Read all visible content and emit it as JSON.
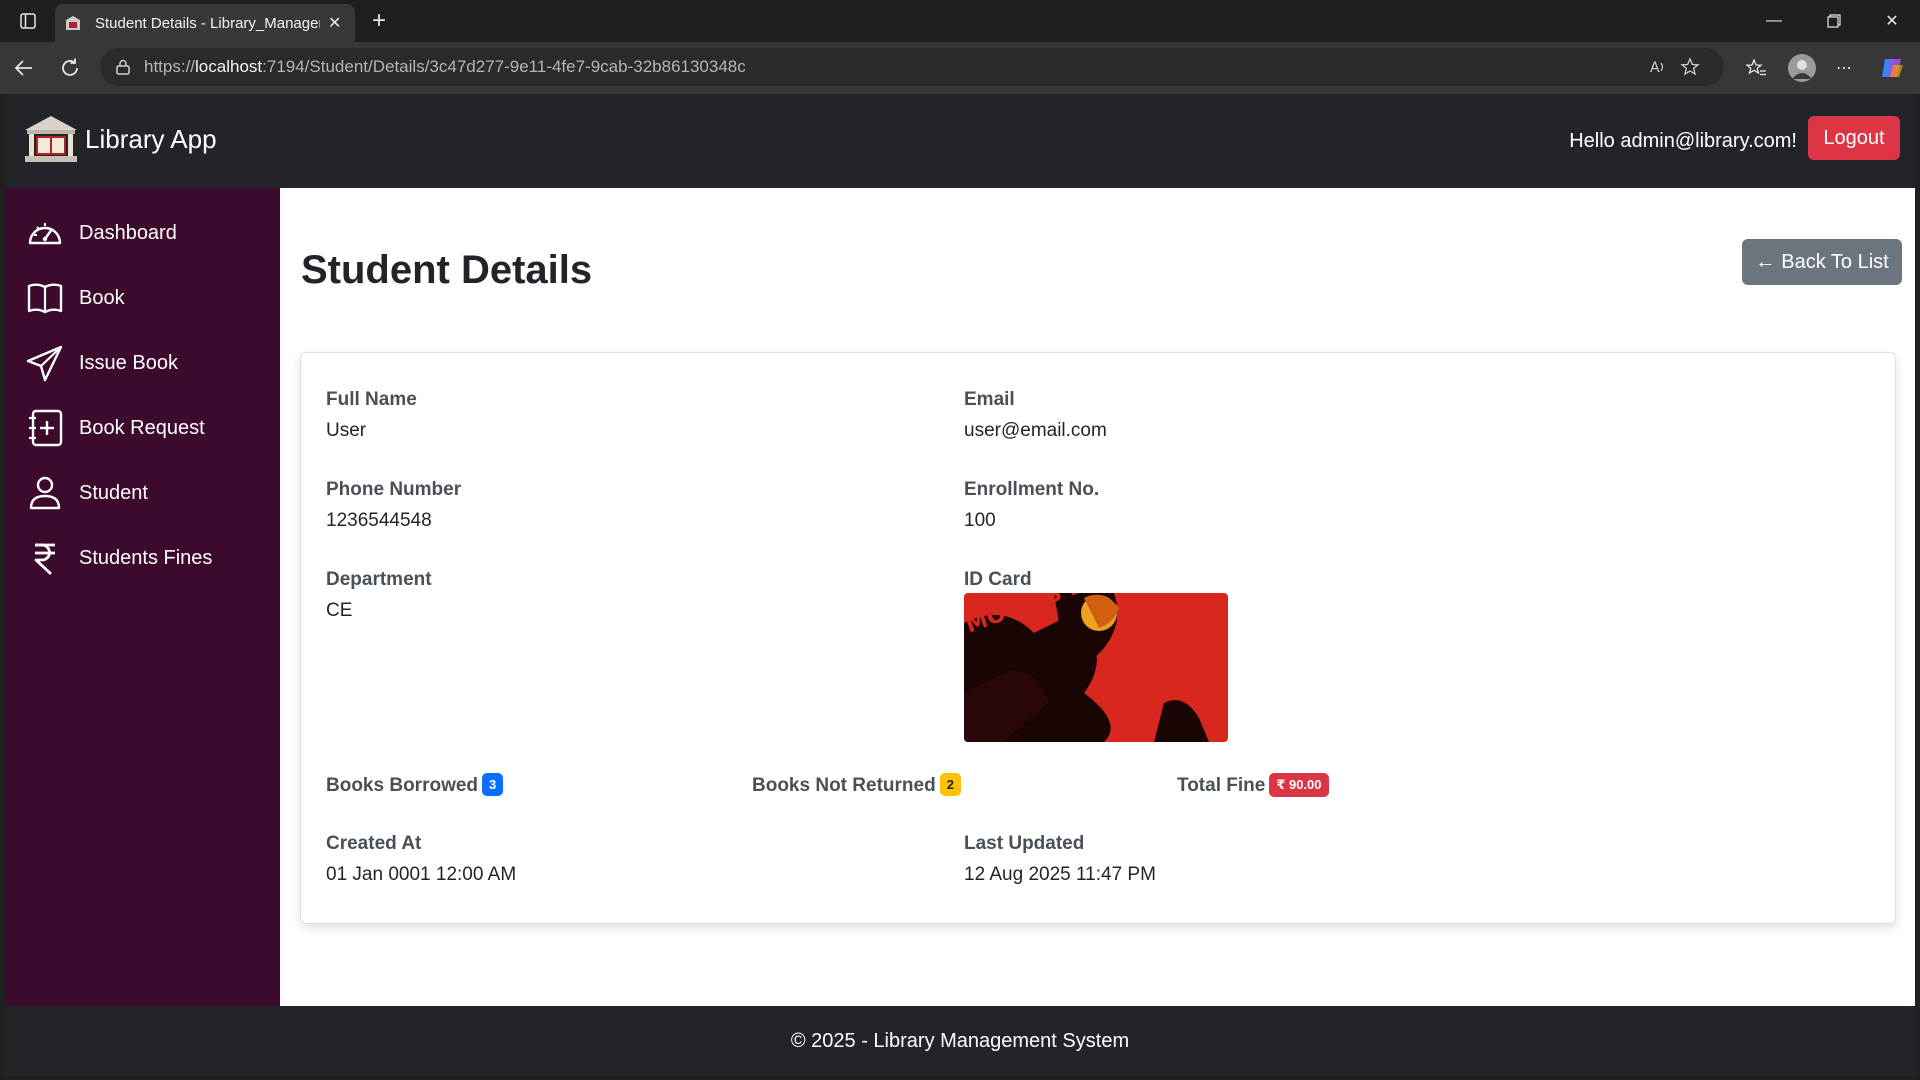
{
  "browser": {
    "tab_title": "Student Details - Library_Management",
    "url_prefix": "https://",
    "url_host": "localhost",
    "url_rest": ":7194/Student/Details/3c47d277-9e11-4fe7-9cab-32b86130348c"
  },
  "app": {
    "brand": "Library App",
    "greeting": "Hello admin@library.com!",
    "logout_label": "Logout"
  },
  "sidebar": {
    "items": [
      {
        "label": "Dashboard",
        "icon": "speedometer-icon"
      },
      {
        "label": "Book",
        "icon": "book-icon"
      },
      {
        "label": "Issue Book",
        "icon": "send-icon"
      },
      {
        "label": "Book Request",
        "icon": "journal-plus-icon"
      },
      {
        "label": "Student",
        "icon": "person-icon"
      },
      {
        "label": "Students Fines",
        "icon": "rupee-icon"
      }
    ]
  },
  "page": {
    "title": "Student Details",
    "back_label": "Back To List"
  },
  "student": {
    "full_name_label": "Full Name",
    "full_name": "User",
    "email_label": "Email",
    "email": "user@email.com",
    "phone_label": "Phone Number",
    "phone": "1236544548",
    "enrollment_label": "Enrollment No.",
    "enrollment": "100",
    "department_label": "Department",
    "department": "CE",
    "idcard_label": "ID Card",
    "idcard_text": "MOON'S EYEAN",
    "books_borrowed_label": "Books Borrowed",
    "books_borrowed": "3",
    "books_not_returned_label": "Books Not Returned",
    "books_not_returned": "2",
    "total_fine_label": "Total Fine",
    "total_fine": "₹ 90.00",
    "created_label": "Created At",
    "created": "01 Jan 0001 12:00 AM",
    "updated_label": "Last Updated",
    "updated": "12 Aug 2025 11:47 PM"
  },
  "footer": {
    "text": "© 2025 - Library Management System"
  },
  "colors": {
    "navbar": "#212529",
    "sidebar": "#3c0a2c",
    "danger": "#dc3545",
    "secondary": "#6c757d",
    "primary": "#0d6efd",
    "warning": "#ffc107"
  }
}
